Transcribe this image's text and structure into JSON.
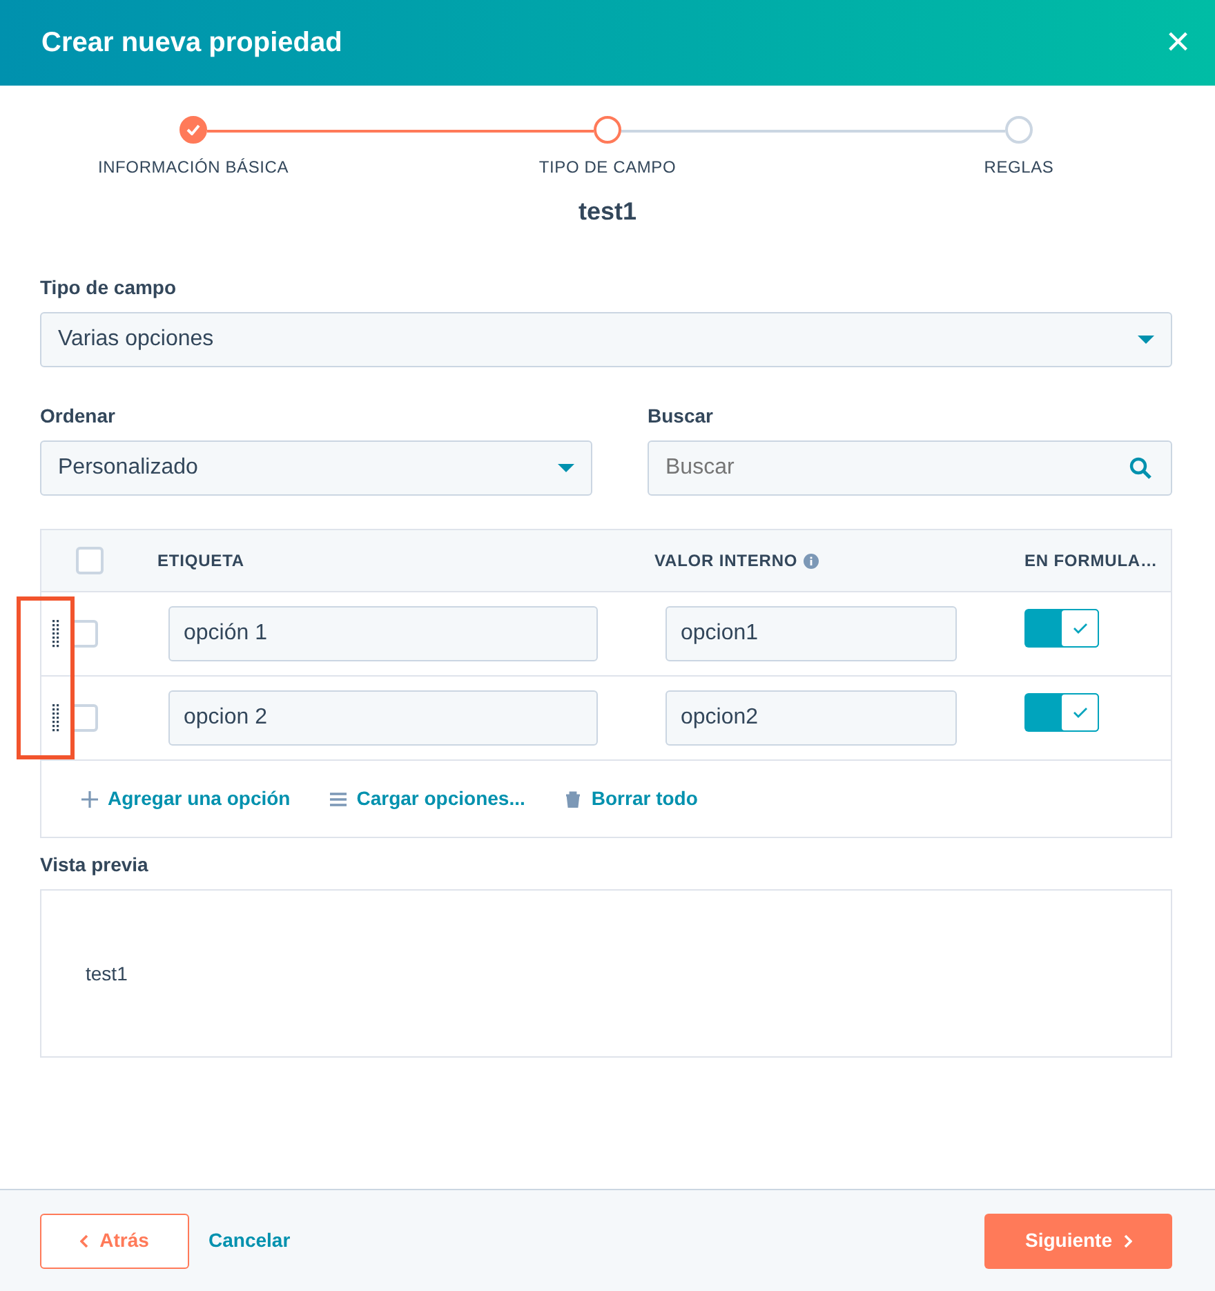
{
  "header": {
    "title": "Crear nueva propiedad",
    "close": "×"
  },
  "steps": [
    {
      "label": "INFORMACIÓN BÁSICA",
      "completed": true,
      "selected": false
    },
    {
      "label": "TIPO DE CAMPO",
      "completed": false,
      "selected": true
    },
    {
      "label": "REGLAS",
      "completed": false,
      "selected": false
    }
  ],
  "property_name": "test1",
  "field_type": {
    "label": "Tipo de campo",
    "value": "Varias opciones"
  },
  "sort": {
    "label": "Ordenar",
    "value": "Personalizado"
  },
  "search": {
    "label": "Buscar",
    "placeholder": "Buscar"
  },
  "options_table": {
    "select_all_checked": false,
    "columns": [
      "ETIQUETA",
      "VALOR INTERNO",
      "EN FORMULA…"
    ],
    "drag_handles_highlighted": true,
    "rows": [
      {
        "checked": false,
        "label": "opción 1",
        "internal_value": "opcion1",
        "in_form": true
      },
      {
        "checked": false,
        "label": "opcion 2",
        "internal_value": "opcion2",
        "in_form": true
      }
    ],
    "actions": [
      {
        "kind": "add",
        "label": "Agregar una opción"
      },
      {
        "kind": "load",
        "label": "Cargar opciones..."
      },
      {
        "kind": "delete",
        "label": "Borrar todo"
      }
    ]
  },
  "preview": {
    "label": "Vista previa",
    "text": "test1"
  },
  "footer": {
    "back": "Atrás",
    "cancel": "Cancelar",
    "next": "Siguiente"
  }
}
